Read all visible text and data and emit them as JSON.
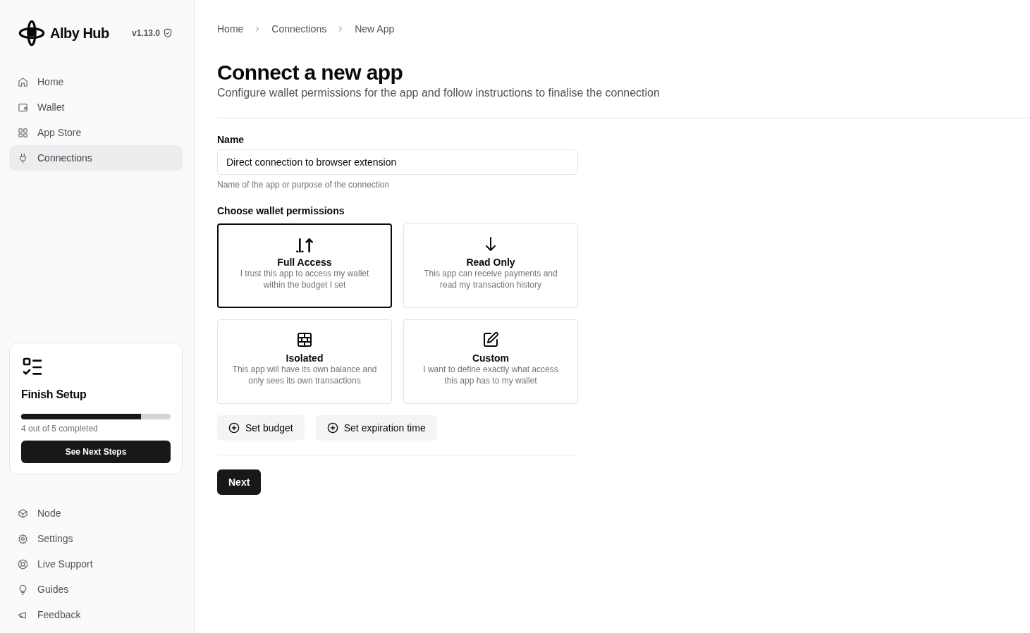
{
  "sidebar": {
    "brand": "Alby Hub",
    "version": "v1.13.0",
    "nav": [
      {
        "label": "Home",
        "selected": false
      },
      {
        "label": "Wallet",
        "selected": false
      },
      {
        "label": "App Store",
        "selected": false
      },
      {
        "label": "Connections",
        "selected": true
      }
    ],
    "setup": {
      "title": "Finish Setup",
      "level": 0.8,
      "progress": "4 out of 5 completed",
      "button": "See Next Steps"
    },
    "footer_nav": [
      {
        "label": "Node"
      },
      {
        "label": "Settings"
      },
      {
        "label": "Live Support"
      },
      {
        "label": "Guides"
      },
      {
        "label": "Feedback"
      }
    ]
  },
  "breadcrumb": [
    "Home",
    "Connections",
    "New App"
  ],
  "title": "Connect a new app",
  "subtitle": "Configure wallet permissions for the app and follow instructions to finalise the connection",
  "name_field": {
    "label": "Name",
    "value": "Direct connection to browser extension",
    "hint": "Name of the app or purpose of the connection"
  },
  "permissions": {
    "label": "Choose wallet permissions",
    "options": [
      {
        "title": "Full Access",
        "description": "I trust this app to access my wallet within the budget I set",
        "selected": true
      },
      {
        "title": "Read Only",
        "description": "This app can receive payments and read my transaction history",
        "selected": false
      },
      {
        "title": "Isolated",
        "description": "This app will have its own balance and only sees its own transactions",
        "selected": false
      },
      {
        "title": "Custom",
        "description": "I want to define exactly what access this app has to my wallet",
        "selected": false
      }
    ]
  },
  "extra_buttons": [
    "Set budget",
    "Set expiration time"
  ],
  "next_button": "Next"
}
